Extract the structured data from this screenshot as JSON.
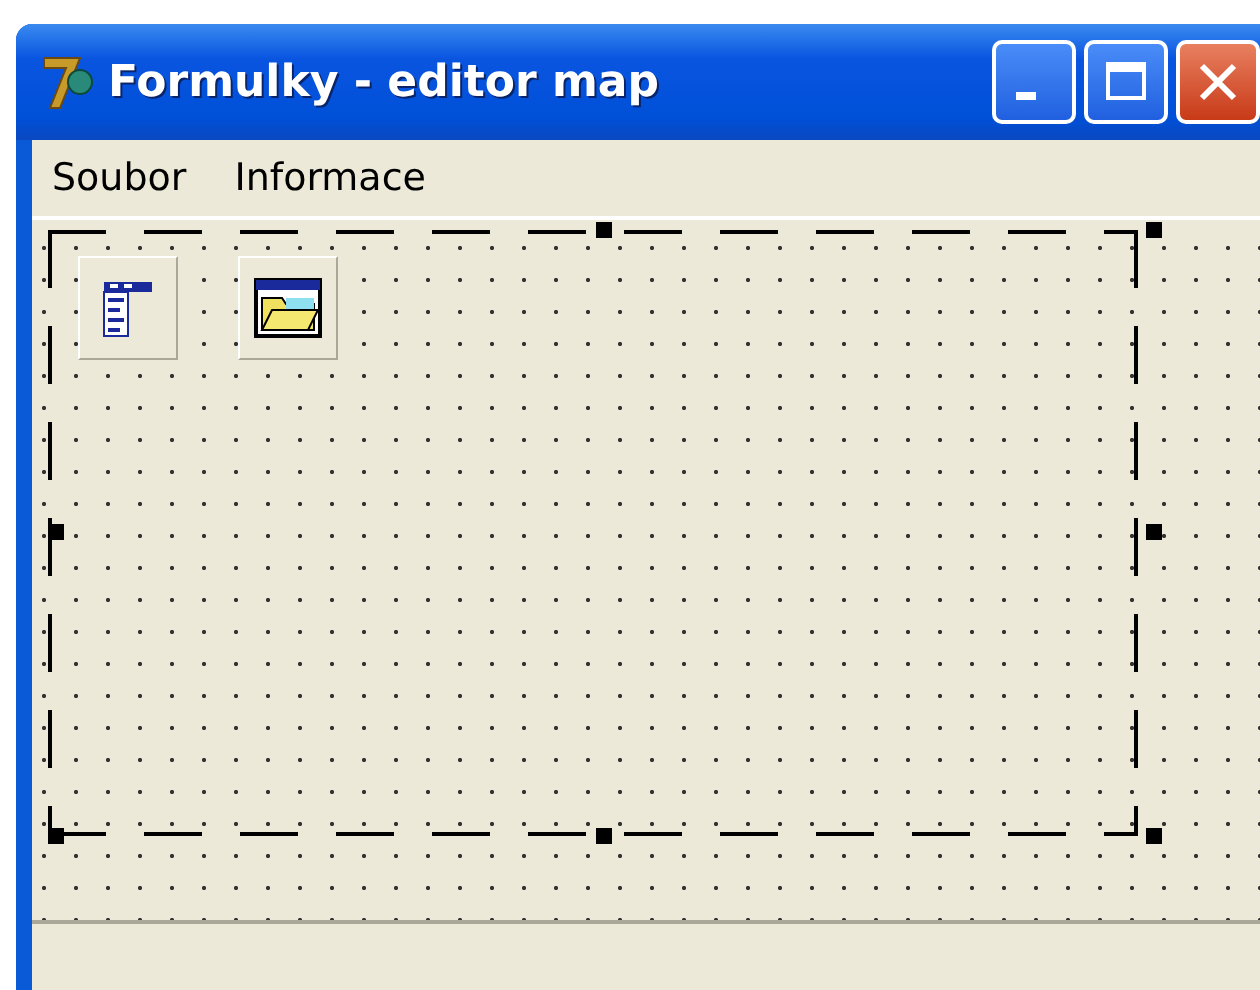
{
  "window": {
    "title": "Formulky - editor map"
  },
  "menu": [
    {
      "label": "Soubor"
    },
    {
      "label": "Informace"
    }
  ]
}
